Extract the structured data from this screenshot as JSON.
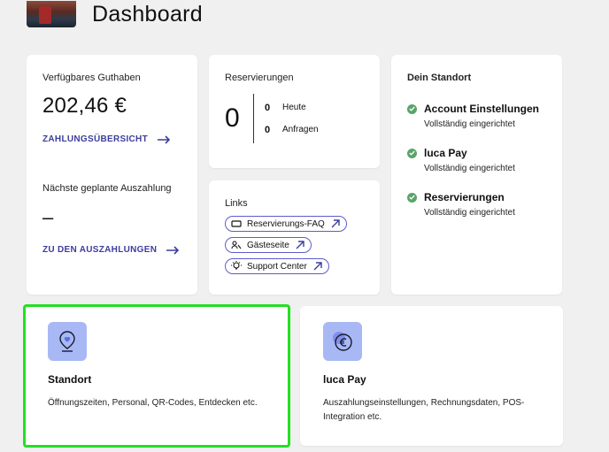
{
  "header": {
    "title": "Dashboard",
    "thumbnail": "venue-thumbnail"
  },
  "guthaben": {
    "label": "Verfügbares Guthaben",
    "amount": "202,46 €",
    "link": "ZAHLUNGSÜBERSICHT",
    "payout_label": "Nächste geplante Auszahlung",
    "payout_value": "–",
    "payout_link": "ZU DEN AUSZAHLUNGEN"
  },
  "reservierungen": {
    "title": "Reservierungen",
    "total": "0",
    "rows": [
      {
        "count": "0",
        "label": "Heute"
      },
      {
        "count": "0",
        "label": "Anfragen"
      }
    ]
  },
  "links": {
    "title": "Links",
    "items": [
      {
        "label": "Reservierungs-FAQ",
        "icon": "ticket-icon"
      },
      {
        "label": "Gästeseite",
        "icon": "guests-icon"
      },
      {
        "label": "Support Center",
        "icon": "lightbulb-icon"
      }
    ]
  },
  "standort": {
    "title": "Dein Standort",
    "items": [
      {
        "title": "Account Einstellungen",
        "status": "Vollständig eingerichtet"
      },
      {
        "title": "luca Pay",
        "status": "Vollständig eingerichtet"
      },
      {
        "title": "Reservierungen",
        "status": "Vollständig eingerichtet"
      }
    ]
  },
  "tiles": [
    {
      "title": "Standort",
      "description": "Öffnungszeiten, Personal, QR-Codes, Entdecken etc.",
      "icon": "location-pin-icon"
    },
    {
      "title": "luca Pay",
      "description": "Auszahlungseinstellungen, Rechnungsdaten, POS-Integration etc.",
      "icon": "euro-coin-icon"
    }
  ],
  "colors": {
    "accent": "#3d3d9e",
    "check": "#5aa469",
    "tile_icon_bg": "#a8b8f5",
    "highlight": "#22e022"
  }
}
